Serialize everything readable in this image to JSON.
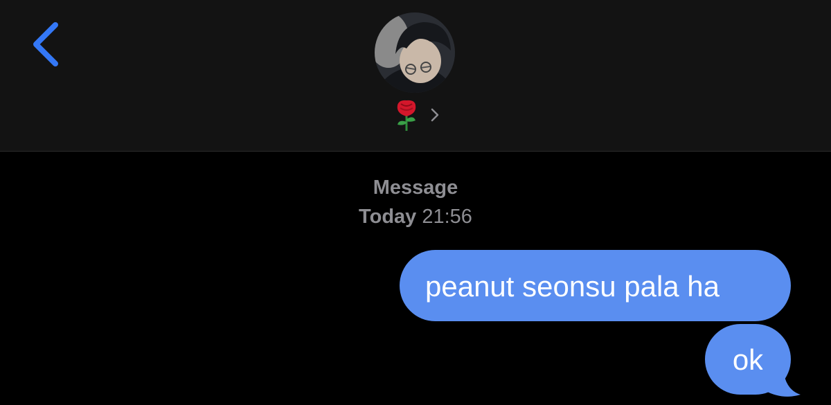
{
  "header": {
    "back_icon": "chevron-left-icon",
    "avatar_icon": "contact-avatar-photo",
    "contact_name": "🌹",
    "contact_chevron_icon": "chevron-right-icon"
  },
  "conversation": {
    "service_label": "Message",
    "day_label": "Today",
    "time_label": "21:56",
    "messages": [
      {
        "direction": "outgoing",
        "text": "peanut seonsu pala ha"
      },
      {
        "direction": "outgoing",
        "text": "ok"
      }
    ]
  },
  "colors": {
    "accent_blue": "#3478f6",
    "outgoing_bubble": "#5a8ef0",
    "header_bg": "#131313",
    "background": "#000000",
    "meta_text": "#8e8e93"
  }
}
